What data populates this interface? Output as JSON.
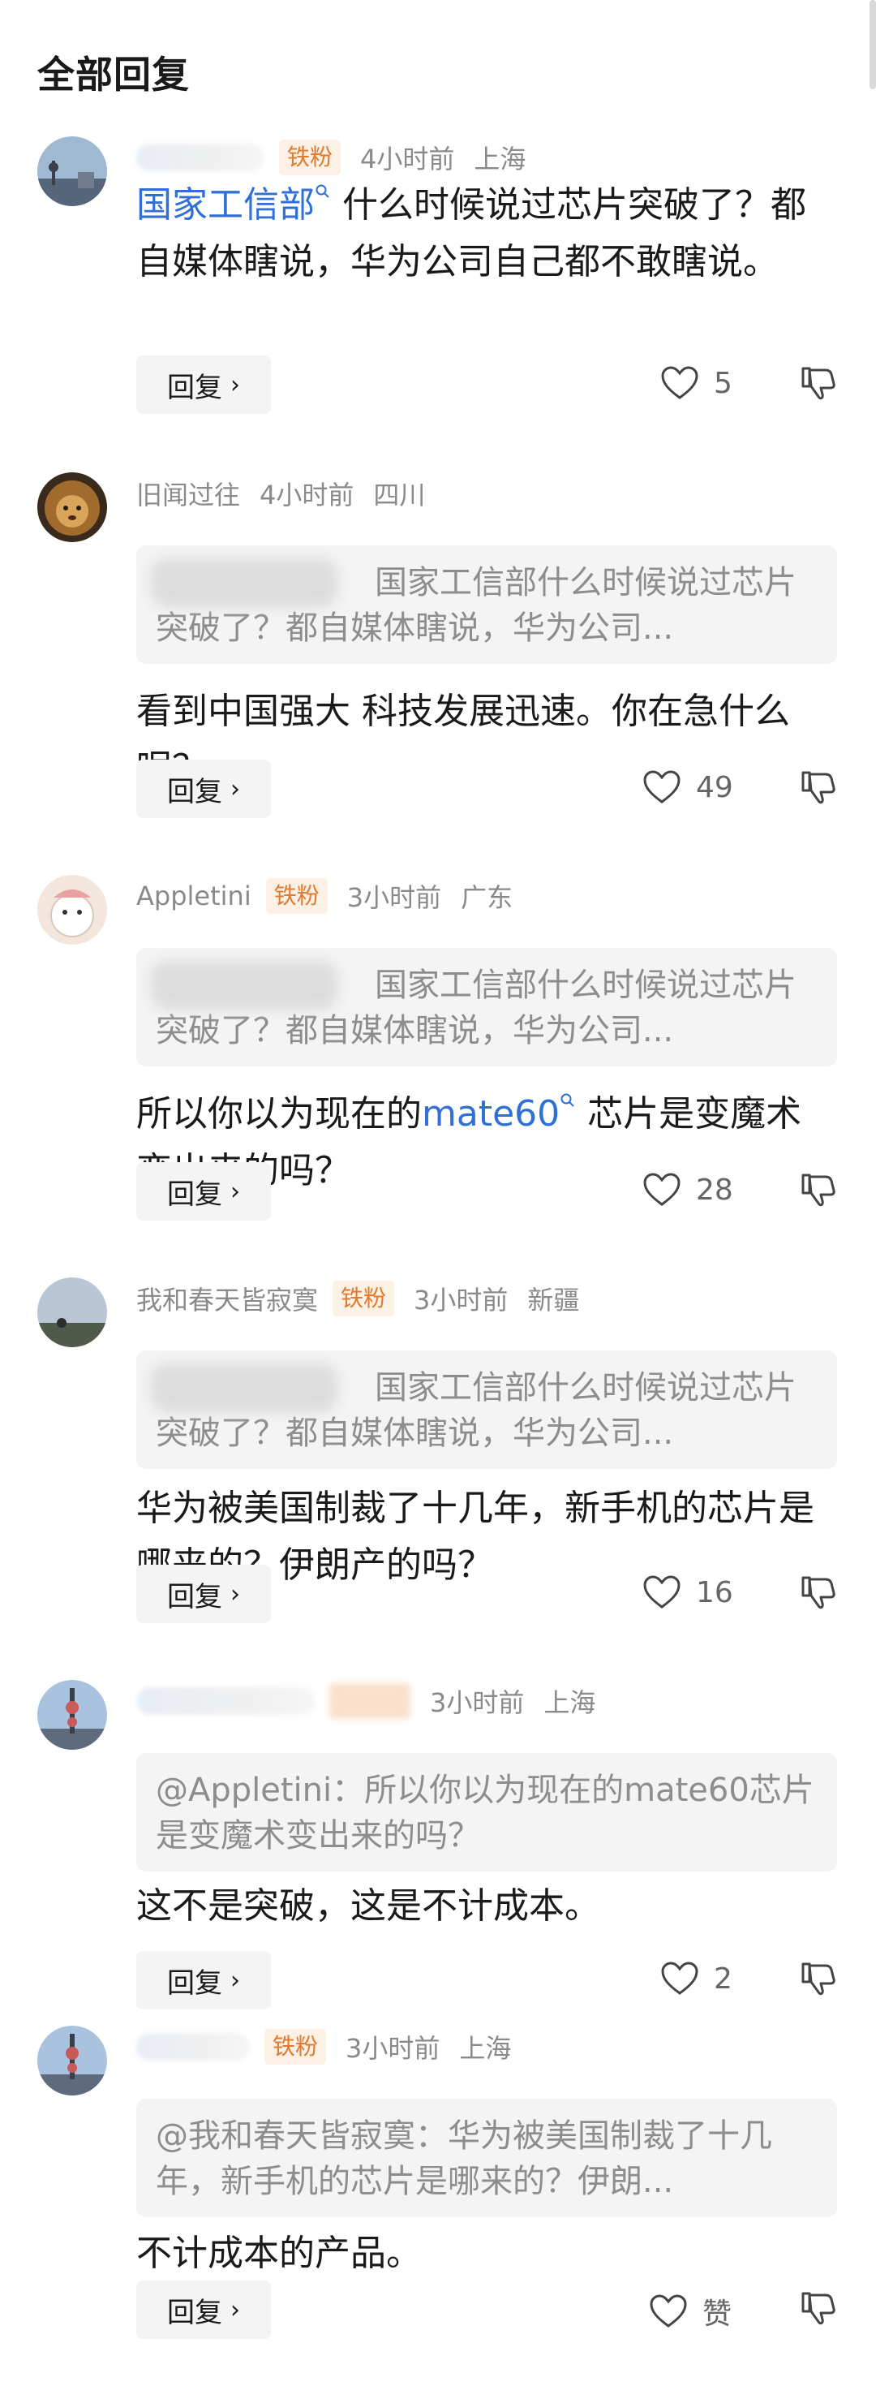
{
  "header": {
    "title": "全部回复"
  },
  "comments": [
    {
      "user": "",
      "badge": "铁粉",
      "time": "4小时前",
      "location": "上海",
      "link_text": "国家工信部",
      "text_after_link": "什么时候说过芯片突破了？都自媒体瞎说，华为公司自己都不敢瞎说。",
      "reply_label": "回复",
      "likes": "5"
    },
    {
      "user": "旧闻过往",
      "badge": "",
      "time": "4小时前",
      "location": "四川",
      "quote": "国家工信部什么时候说过芯片突破了？都自媒体瞎说，华为公司...",
      "text": "看到中国强大 科技发展迅速。你在急什么呢？",
      "reply_label": "回复",
      "likes": "49"
    },
    {
      "user": "Appletini",
      "badge": "铁粉",
      "time": "3小时前",
      "location": "广东",
      "quote": "国家工信部什么时候说过芯片突破了？都自媒体瞎说，华为公司...",
      "text_before_link": "所以你以为现在的",
      "link_text": "mate60",
      "text_after_link": "芯片是变魔术变出来的吗？",
      "reply_label": "回复",
      "likes": "28"
    },
    {
      "user": "我和春天皆寂寞",
      "badge": "铁粉",
      "time": "3小时前",
      "location": "新疆",
      "quote": "国家工信部什么时候说过芯片突破了？都自媒体瞎说，华为公司...",
      "text": "华为被美国制裁了十几年，新手机的芯片是哪来的？伊朗产的吗？",
      "reply_label": "回复",
      "likes": "16"
    },
    {
      "user": "",
      "badge": "",
      "time": "3小时前",
      "location": "上海",
      "quote": "@Appletini：所以你以为现在的mate60芯片是变魔术变出来的吗？",
      "text": "这不是突破，这是不计成本。",
      "reply_label": "回复",
      "likes": "2"
    },
    {
      "user": "",
      "badge": "铁粉",
      "time": "3小时前",
      "location": "上海",
      "quote": "@我和春天皆寂寞：华为被美国制裁了十几年，新手机的芯片是哪来的？伊朗...",
      "text": "不计成本的产品。",
      "reply_label": "回复",
      "likes": "赞"
    }
  ],
  "icons": {
    "like": "heart-outline-icon",
    "dislike": "thumbs-down-icon",
    "search": "search-mini-icon",
    "chevron": "chevron-right-icon"
  },
  "colors": {
    "link": "#2f6fd6",
    "badge_text": "#e07a2e",
    "badge_bg": "#fdf0e4",
    "meta": "#8a8a8a"
  }
}
